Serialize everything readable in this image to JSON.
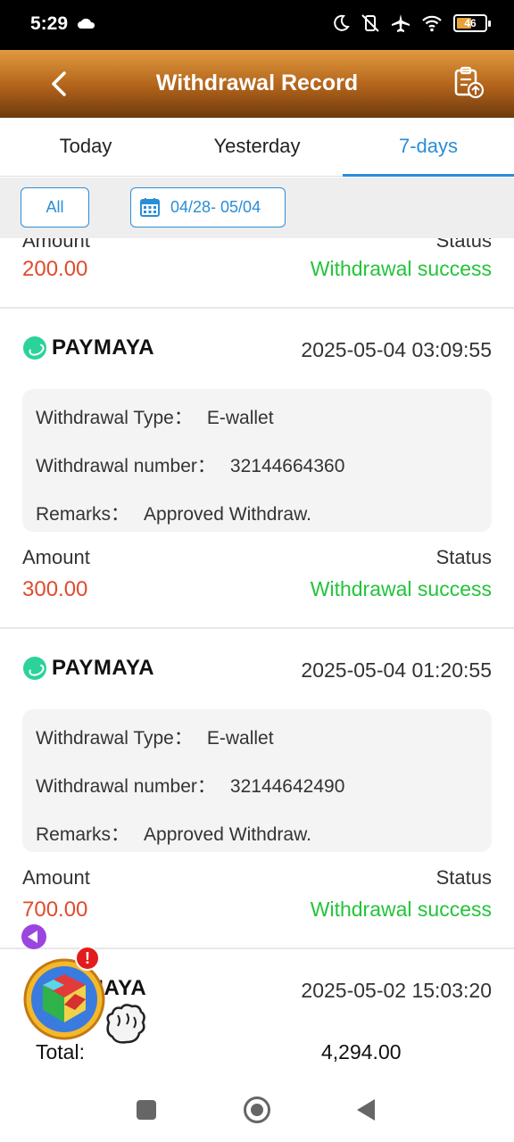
{
  "status_bar": {
    "time": "5:29",
    "battery": "46"
  },
  "header": {
    "title": "Withdrawal Record"
  },
  "tabs": [
    {
      "label": "Today"
    },
    {
      "label": "Yesterday"
    },
    {
      "label": "7-days"
    }
  ],
  "filter": {
    "all_label": "All",
    "date_range": "04/28- 05/04"
  },
  "labels": {
    "withdrawal_type": "Withdrawal Type：",
    "withdrawal_number": "Withdrawal number：",
    "remarks": "Remarks：",
    "amount": "Amount",
    "status": "Status"
  },
  "records": [
    {
      "amount": "200.00",
      "status": "Withdrawal success"
    },
    {
      "brand": "PAYMAYA",
      "date": "2025-05-04 03:09:55",
      "type": "E-wallet",
      "number": "32144664360",
      "remarks": "Approved Withdraw.",
      "amount": "300.00",
      "status": "Withdrawal success"
    },
    {
      "brand": "PAYMAYA",
      "date": "2025-05-04 01:20:55",
      "type": "E-wallet",
      "number": "32144642490",
      "remarks": "Approved Withdraw.",
      "amount": "700.00",
      "status": "Withdrawal success"
    },
    {
      "brand": "MAYA",
      "date": "2025-05-02 15:03:20"
    }
  ],
  "total": {
    "label": "Total:",
    "value": "4,294.00"
  },
  "badge": "!",
  "colors": {
    "accent": "#2a8dd8",
    "amount": "#e04b2d",
    "success": "#22c43a",
    "header": "#b0621a"
  }
}
